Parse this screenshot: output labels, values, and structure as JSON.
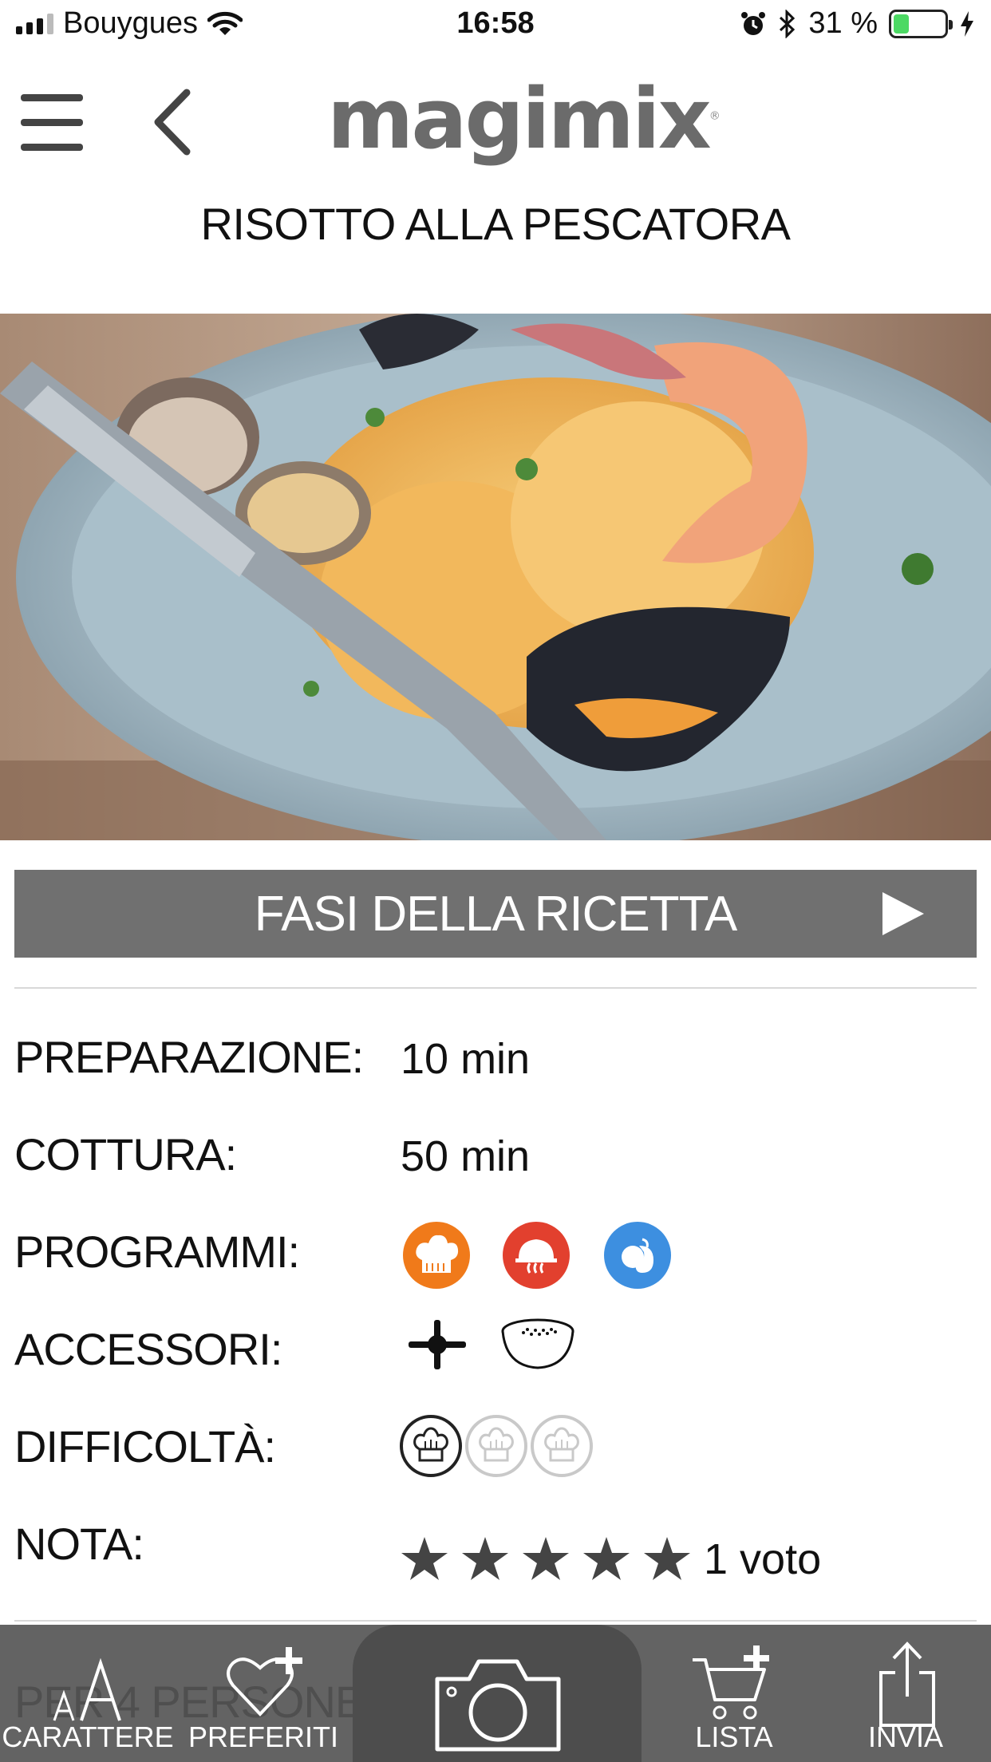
{
  "status_bar": {
    "carrier": "Bouygues",
    "time": "16:58",
    "battery": "31 %",
    "battery_level": 0.31,
    "battery_color": "#4cd964"
  },
  "header": {
    "logo": "magimix",
    "logo_mark": "®",
    "menu_icon": "hamburger-icon",
    "back_icon": "chevron-left-icon"
  },
  "recipe": {
    "title": "RISOTTO ALLA PESCATORA",
    "image_subject": "seafood-risotto-photo"
  },
  "steps_button": {
    "label": "FASI DELLA RICETTA",
    "icon": "play-icon",
    "bg_color": "#707070"
  },
  "info": {
    "preparation_label": "PREPARAZIONE:",
    "preparation_value": "10 min",
    "cooking_label": "COTTURA:",
    "cooking_value": "50 min",
    "programs_label": "PROGRAMMI:",
    "programs": [
      {
        "icon": "chef-hat-icon",
        "color": "#f07a1a"
      },
      {
        "icon": "cloche-steam-icon",
        "color": "#e2402e"
      },
      {
        "icon": "fruit-icon",
        "color": "#3d8fe0"
      }
    ],
    "accessories_label": "ACCESSORI:",
    "accessories": [
      "blade-icon",
      "steamer-basket-icon"
    ],
    "difficulty_label": "DIFFICOLTÀ:",
    "difficulty_level": 1,
    "difficulty_max": 3,
    "rating_label": "NOTA:",
    "rating_stars": 5,
    "rating_votes": "1 voto"
  },
  "toolbar": {
    "hidden_text": "PER 4 PERSONE :",
    "items": [
      {
        "label": "CARATTERE",
        "icon": "font-size-icon"
      },
      {
        "label": "PREFERITI",
        "icon": "heart-plus-icon"
      },
      {
        "label": "",
        "icon": "camera-icon"
      },
      {
        "label": "LISTA",
        "icon": "cart-plus-icon"
      },
      {
        "label": "INVIA",
        "icon": "share-icon"
      }
    ]
  }
}
